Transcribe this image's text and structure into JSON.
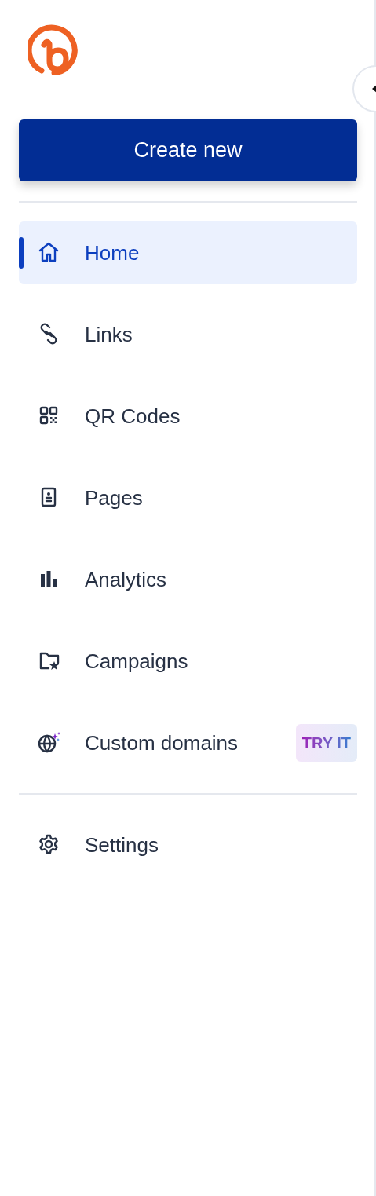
{
  "create_button": {
    "label": "Create new"
  },
  "nav": [
    {
      "label": "Home",
      "selected": true
    },
    {
      "label": "Links",
      "selected": false
    },
    {
      "label": "QR Codes",
      "selected": false
    },
    {
      "label": "Pages",
      "selected": false
    },
    {
      "label": "Analytics",
      "selected": false
    },
    {
      "label": "Campaigns",
      "selected": false
    },
    {
      "label": "Custom domains",
      "selected": false,
      "badge": "TRY IT"
    }
  ],
  "footer_nav": [
    {
      "label": "Settings",
      "selected": false
    }
  ]
}
